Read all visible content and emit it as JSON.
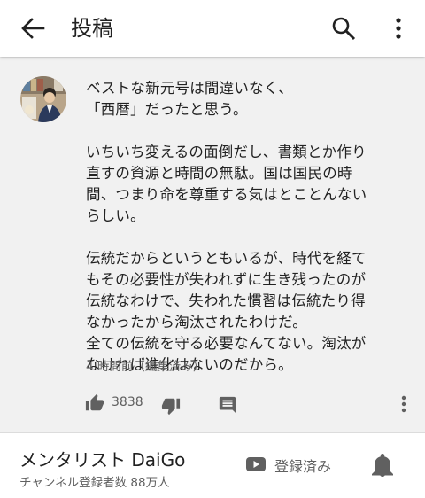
{
  "header": {
    "title": "投稿",
    "back_icon": "arrow-back-icon",
    "search_icon": "search-icon",
    "more_icon": "more-vert-icon"
  },
  "post": {
    "author_avatar": "avatar",
    "paragraphs": [
      "ベストな新元号は間違いなく、\n「西暦」だったと思う。",
      "いちいち変えるの面倒だし、書類とか作り\n直すの資源と時間の無駄。国は国民の時\n間、つまり命を尊重する気はとことんない\nらしい。",
      "伝統だからというともいるが、時代を経て\nもその必要性が失われずに生き残ったのが\n伝統なわけで、失われた慣習は伝統たり得\nなかったから淘汰されたわけだ。\n全ての伝統を守る必要なんてない。淘汰が\nなければ進化はないのだから。"
    ],
    "timestamp": "4 時間前（編集済み）",
    "like_count": "3838",
    "like_icon": "thumb-up-icon",
    "dislike_icon": "thumb-down-icon",
    "comment_icon": "comment-icon",
    "more_icon": "more-vert-icon"
  },
  "channel": {
    "name": "メンタリスト DaiGo",
    "subscribers": "チャンネル登録者数 88万人",
    "subscribed_label": "登録済み",
    "subscribed_icon": "youtube-icon",
    "bell_icon": "bell-icon"
  },
  "colors": {
    "content_background": "#f1f1f1",
    "secondary_text": "#606060",
    "primary_text": "#212121",
    "icon_gray": "#606060"
  }
}
